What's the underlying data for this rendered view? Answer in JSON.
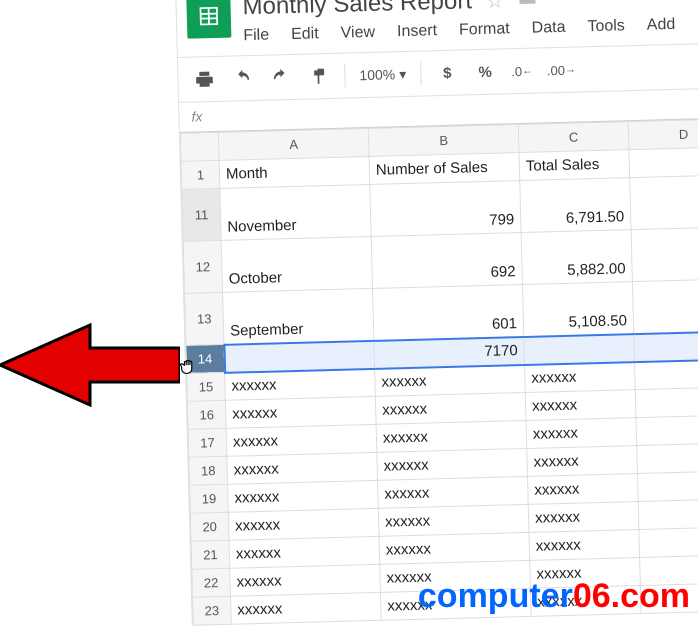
{
  "doc": {
    "title": "Monthly Sales Report"
  },
  "menu": {
    "file": "File",
    "edit": "Edit",
    "view": "View",
    "insert": "Insert",
    "format": "Format",
    "data": "Data",
    "tools": "Tools",
    "add": "Add"
  },
  "toolbar": {
    "zoom": "100%",
    "currency": "$",
    "percent": "%",
    "dec_less": ".0",
    "dec_more": ".00"
  },
  "fx": {
    "label": "fx"
  },
  "columns": {
    "A": "A",
    "B": "B",
    "C": "C",
    "D": "D"
  },
  "headers": {
    "month": "Month",
    "num_sales": "Number of Sales",
    "total_sales": "Total Sales"
  },
  "rows": {
    "r1": "1",
    "r11": "11",
    "r12": "12",
    "r13": "13",
    "r14": "14",
    "r15": "15",
    "r16": "16",
    "r17": "17",
    "r18": "18",
    "r19": "19",
    "r20": "20",
    "r21": "21",
    "r22": "22",
    "r23": "23"
  },
  "data": {
    "nov": {
      "month": "November",
      "num": "799",
      "total": "6,791.50"
    },
    "oct": {
      "month": "October",
      "num": "692",
      "total": "5,882.00"
    },
    "sep": {
      "month": "September",
      "num": "601",
      "total": "5,108.50"
    },
    "sum": {
      "num": "7170"
    }
  },
  "placeholder": "xxxxxx",
  "watermark": {
    "left": "computer",
    "right": "06.com"
  }
}
